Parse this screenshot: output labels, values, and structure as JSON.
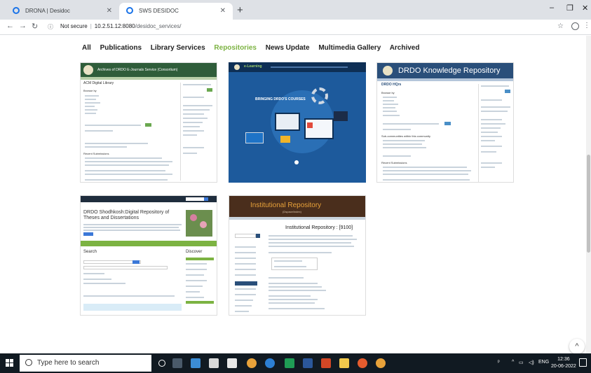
{
  "browser": {
    "tabs": [
      {
        "title": "DRONA | Desidoc",
        "active": false
      },
      {
        "title": "SWS DESIDOC",
        "active": true
      }
    ],
    "new_tab": "+",
    "window_controls": {
      "minimize": "–",
      "maximize": "❐",
      "close": "✕"
    },
    "address": {
      "security": "Not secure",
      "host": "10.2.51.12:8080",
      "path": "/desidoc_services/"
    }
  },
  "site_nav": {
    "items": [
      "All",
      "Publications",
      "Library Services",
      "Repositories",
      "News Update",
      "Multimedia Gallery",
      "Archived"
    ],
    "active": "Repositories",
    "active_color": "#7cb342"
  },
  "cards": {
    "c1": {
      "header": "Archives of DRDO E-Journals Service (Consortium)",
      "title": "ACM Digital Library",
      "section": "Browse by",
      "section2": "Recent Submissions"
    },
    "c2": {
      "banner": "BRINGING DRDO'S COURSES",
      "brand": "e-Learning"
    },
    "c3": {
      "header": "DRDO Knowledge Repository",
      "title": "DRDO HQrs",
      "section": "Browse by",
      "section2": "Sub-communities within this community",
      "section3": "Recent Submissions"
    },
    "c4": {
      "title": "DRDO Shodhkosh:Digital Repository of Theses and Dissertations",
      "search_label": "Search",
      "discover_label": "Discover"
    },
    "c5": {
      "header": "Institutional Repository",
      "subheader": "(Dspace/index)",
      "title": "Institutional Repository : [9100]"
    }
  },
  "taskbar": {
    "search_placeholder": "Type here to search",
    "tray_text": "ENG",
    "time": "12:36",
    "date": "20-06-2022"
  }
}
